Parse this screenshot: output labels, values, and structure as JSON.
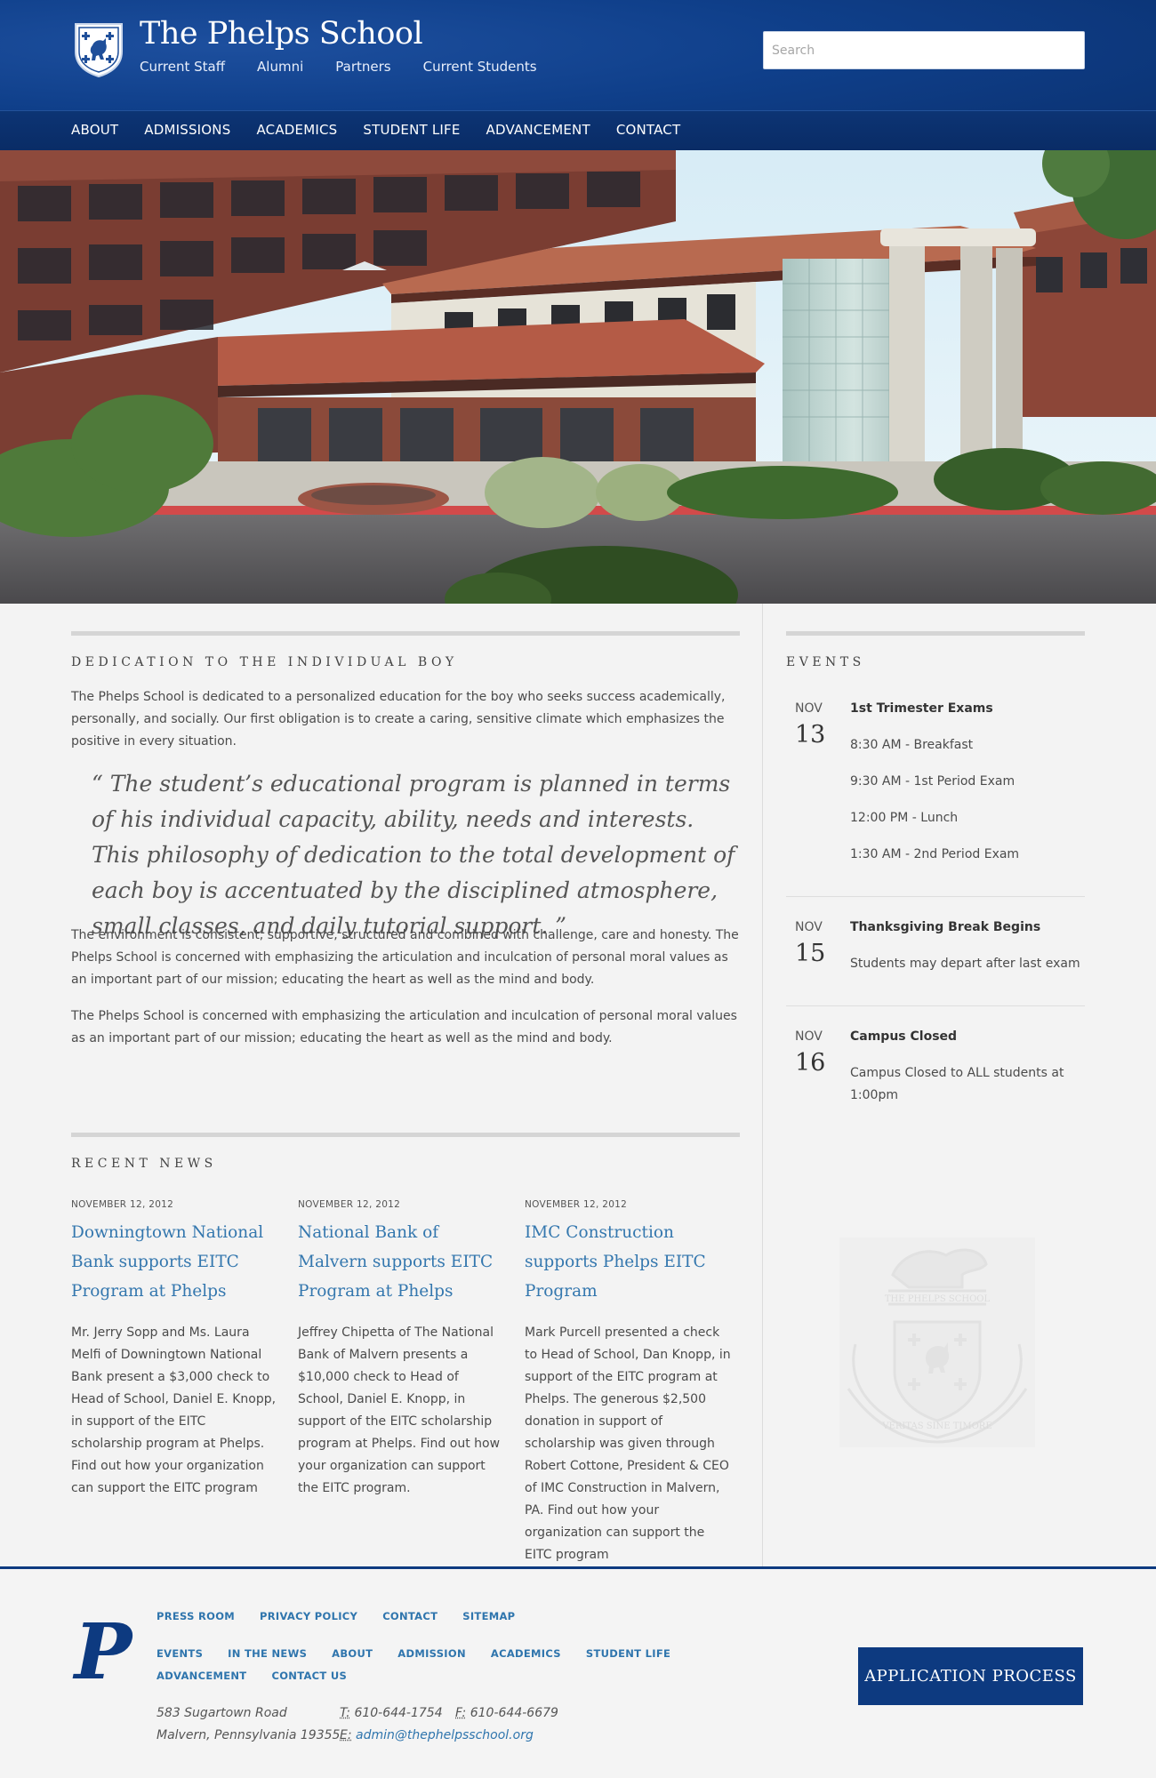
{
  "header": {
    "site_title": "The Phelps School",
    "util_nav": [
      "Current Staff",
      "Alumni",
      "Partners",
      "Current Students"
    ],
    "search_placeholder": "Search"
  },
  "main_nav": [
    "ABOUT",
    "ADMISSIONS",
    "ACADEMICS",
    "STUDENT LIFE",
    "ADVANCEMENT",
    "CONTACT"
  ],
  "intro": {
    "title": "DEDICATION TO THE INDIVIDUAL BOY",
    "paragraph1": "The Phelps School is dedicated to a personalized education for the boy who seeks success academically, personally, and socially. Our first obligation is to create a caring, sensitive climate which emphasizes the positive in every situation.",
    "quote": "“ The student’s educational program is planned in terms of his individual capacity, ability, needs and interests. This philosophy of dedication to the total development of each boy is accentuated by the disciplined atmosphere, small classes, and daily tutorial support. ”",
    "paragraph2": "The environment is consistent, supportive, structured and combined with challenge, care and honesty. The Phelps School is concerned with emphasizing the articulation and inculcation of personal moral values as an important part of our mission; educating the heart as well as the mind and body.",
    "paragraph3": "The Phelps School is concerned with emphasizing the articulation and inculcation of personal moral values as an important part of our mission; educating the heart as well as the mind and body."
  },
  "news": {
    "title": "RECENT NEWS",
    "items": [
      {
        "date": "NOVEMBER 12, 2012",
        "title": "Downingtown National Bank supports EITC Program at Phelps",
        "body": "Mr. Jerry Sopp and Ms. Laura Melfi of Downingtown National Bank present a $3,000 check to Head of School, Daniel E. Knopp, in support of the EITC scholarship program at Phelps. Find out how your organization can support the EITC program"
      },
      {
        "date": "NOVEMBER 12, 2012",
        "title": "National Bank of Malvern supports EITC Program at Phelps",
        "body": "Jeffrey Chipetta of The National Bank of Malvern presents a $10,000 check to Head of School, Daniel E. Knopp, in support of the EITC scholarship program at Phelps. Find out how your organization can support the EITC program."
      },
      {
        "date": "NOVEMBER 12, 2012",
        "title": "IMC Construction supports Phelps EITC Program",
        "body": "Mark Purcell presented a check to Head of School, Dan Knopp, in support of the EITC program at Phelps. The generous $2,500 donation in support of scholarship was given through Robert Cottone, President & CEO of IMC Construction in Malvern, PA. Find out how your organization can support the EITC program"
      }
    ]
  },
  "events": {
    "title": "EVENTS",
    "items": [
      {
        "month": "NOV",
        "day": "13",
        "title": "1st Trimester Exams",
        "details": [
          "8:30 AM - Breakfast",
          "9:30 AM - 1st Period Exam",
          "12:00 PM - Lunch",
          "1:30 AM - 2nd Period Exam"
        ]
      },
      {
        "month": "NOV",
        "day": "15",
        "title": "Thanksgiving Break Begins",
        "details": [
          "Students may depart after last exam"
        ]
      },
      {
        "month": "NOV",
        "day": "16",
        "title": "Campus Closed",
        "details": [
          "Campus Closed to ALL students at",
          "1:00pm"
        ]
      }
    ],
    "seal_text": [
      "THE PHELPS SCHOOL",
      "VERITAS SINE TIMORE"
    ]
  },
  "footer": {
    "logo_letter": "P",
    "links_row1": [
      "PRESS ROOM",
      "PRIVACY POLICY",
      "CONTACT",
      "SITEMAP"
    ],
    "links_row2": [
      "EVENTS",
      "IN THE NEWS",
      "ABOUT",
      "ADMISSION",
      "ACADEMICS",
      "STUDENT LIFE",
      "ADVANCEMENT",
      "CONTACT US"
    ],
    "address_line1": "583 Sugartown Road",
    "address_line2": "Malvern, Pennsylvania 19355",
    "phone_label": "T:",
    "phone": "610-644-1754",
    "fax_label": "F:",
    "fax": "610-644-6679",
    "email_label": "E:",
    "email": "admin@thephelpsschool.org",
    "app_button": "APPLICATION PROCESS"
  },
  "colors": {
    "brand_blue": "#0d3a80",
    "link_blue": "#3477ae",
    "background": "#f3f3f3"
  }
}
